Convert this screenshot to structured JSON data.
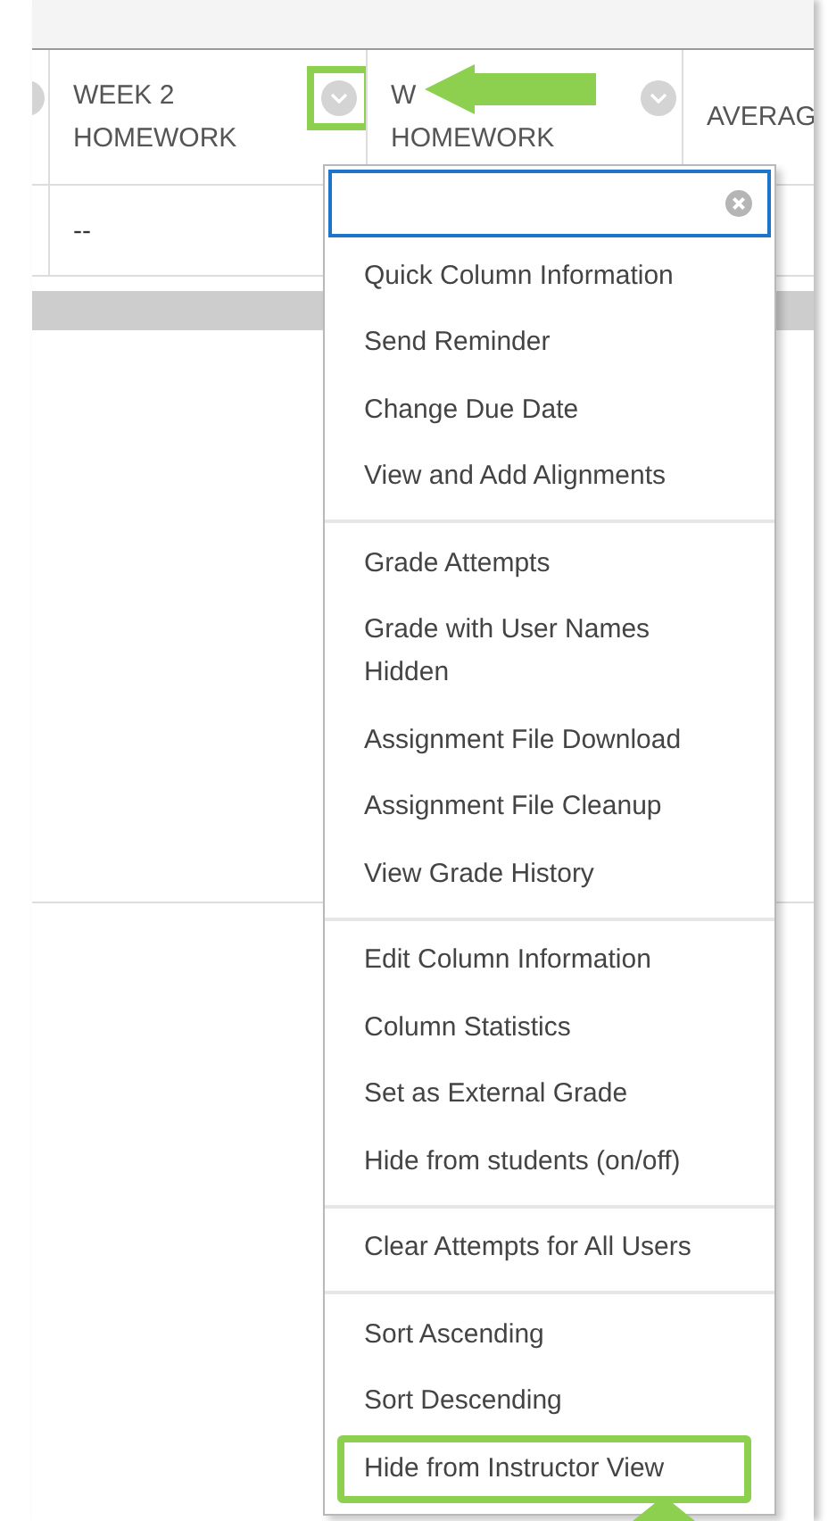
{
  "grade_center": {
    "columns": [
      {
        "menu_button": true
      },
      {
        "lines": [
          "WEEK 2",
          "HOMEWORK"
        ],
        "menu_button": true,
        "highlighted": true
      },
      {
        "lines": [
          "W",
          "HOMEWORK"
        ],
        "menu_button": true
      },
      {
        "lines": [
          "AVERAG"
        ],
        "menu_button": false
      }
    ],
    "rows": [
      {
        "week_2_homework": "--"
      }
    ]
  },
  "column_menu": {
    "groups": [
      {
        "items": [
          {
            "label": "Quick Column Information",
            "highlighted": false
          },
          {
            "label": "Send Reminder",
            "highlighted": false
          },
          {
            "label": "Change Due Date",
            "highlighted": false
          },
          {
            "label": "View and Add Alignments",
            "highlighted": false
          }
        ]
      },
      {
        "items": [
          {
            "label": "Grade Attempts",
            "highlighted": false
          },
          {
            "label": "Grade with User Names Hidden",
            "highlighted": false
          },
          {
            "label": "Assignment File Download",
            "highlighted": false
          },
          {
            "label": "Assignment File Cleanup",
            "highlighted": false
          },
          {
            "label": "View Grade History",
            "highlighted": false
          }
        ]
      },
      {
        "items": [
          {
            "label": "Edit Column Information",
            "highlighted": false
          },
          {
            "label": "Column Statistics",
            "highlighted": false
          },
          {
            "label": "Set as External Grade",
            "highlighted": false
          },
          {
            "label": "Hide from students (on/off)",
            "highlighted": false
          }
        ]
      },
      {
        "items": [
          {
            "label": "Clear Attempts for All Users",
            "highlighted": false
          }
        ]
      },
      {
        "items": [
          {
            "label": "Sort Ascending",
            "highlighted": false
          },
          {
            "label": "Sort Descending",
            "highlighted": false
          },
          {
            "label": "Hide from Instructor View",
            "highlighted": true
          }
        ]
      }
    ]
  }
}
